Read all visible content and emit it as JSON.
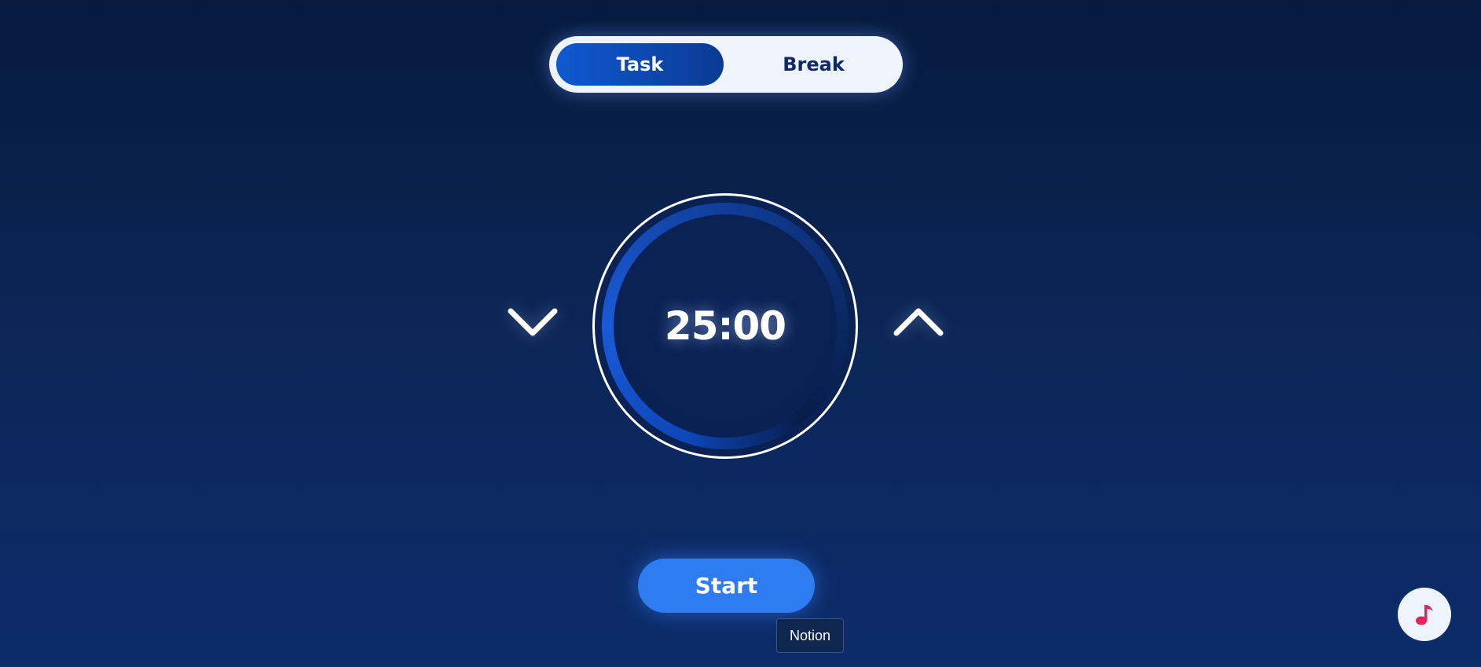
{
  "mode_toggle": {
    "task_label": "Task",
    "break_label": "Break",
    "active": "Task"
  },
  "timer": {
    "display": "25:00",
    "decrease_icon": "chevron-down-icon",
    "increase_icon": "chevron-up-icon"
  },
  "start_button": {
    "label": "Start"
  },
  "tooltip": {
    "text": "Notion"
  },
  "music_button": {
    "icon": "music-note-icon",
    "icon_color": "#e0245e"
  },
  "colors": {
    "background_top": "#071a3e",
    "background_bottom": "#0c2c6a",
    "accent": "#2f7bf0",
    "toggle_active": "#1059d0",
    "toggle_text": "#0d2a66"
  }
}
